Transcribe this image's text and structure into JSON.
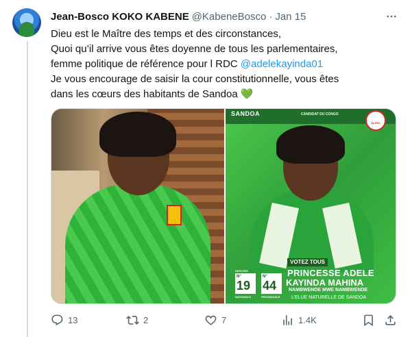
{
  "author": {
    "name": "Jean-Bosco KOKO KABENE",
    "handle": "@KabeneBosco",
    "separator": "·",
    "date": "Jan 15"
  },
  "tweet": {
    "line1": "Dieu est le Maître des temps et des circonstances,",
    "line2": "Quoi qu’il arrive vous êtes doyenne de tous les parlementaires,",
    "line3_prefix": "femme politique  de référence pour l RDC ",
    "line3_mention": "@adelekayinda01",
    "line4": "Je vous encourage de saisir la cour constitutionnelle, vous êtes",
    "line5": "dans les cœurs des habitants de Sandoa ",
    "line5_emoji": "💚"
  },
  "poster": {
    "region": "SANDOA",
    "candidate_header": "CANDIDAT DU CONGO",
    "logo_text": "ALDEC",
    "votez": "VOTEZ TOUS",
    "deputee": "DEPUTEE",
    "national": {
      "no_label": "N°",
      "number": "19",
      "label": "NATIONALE"
    },
    "provincial": {
      "no_label": "N°",
      "number": "44",
      "label": "PROVINCIALE"
    },
    "first_name": "PRINCESSE ADELE",
    "last_name": "KAYINDA MAHINA",
    "motto": "NAMBWENDE MWE NAMBWENDE",
    "tagline": "L’ELUE NATURELLE DE SANDOA"
  },
  "actions": {
    "reply_count": "13",
    "retweet_count": "2",
    "like_count": "7",
    "views_count": "1.4K"
  },
  "icons": [
    "more-icon",
    "reply-icon",
    "retweet-icon",
    "like-icon",
    "views-icon",
    "bookmark-icon",
    "share-icon"
  ],
  "colors": {
    "text": "#0f1419",
    "muted": "#536471",
    "link": "#1d9bf0",
    "border": "#cfd9de",
    "poster_green": "#3fbe44"
  }
}
